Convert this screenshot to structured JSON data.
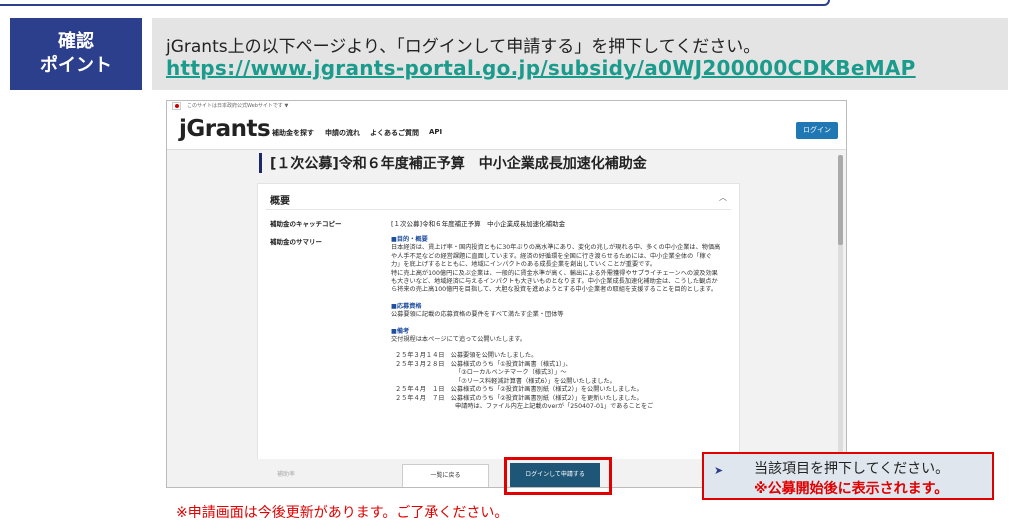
{
  "badge": {
    "line1": "確認",
    "line2": "ポイント"
  },
  "banner": {
    "instruction": "jGrants上の以下ページより、「ログインして申請する」を押下してください。",
    "url": "https://www.jgrants-portal.go.jp/subsidy/a0WJ200000CDKBeMAP"
  },
  "site": {
    "gov_notice": "このサイトは日本政府公式Webサイトです ▼",
    "logo_main": "jGrants",
    "nav": [
      "補助金を探す",
      "申請の流れ",
      "よくあるご質問",
      "API"
    ],
    "login_label": "ログイン",
    "page_title": "[１次公募]令和６年度補正予算　中小企業成長加速化補助金",
    "section_title": "概要",
    "catch_label": "補助金のキャッチコピー",
    "catch_value": "[１次公募]令和６年度補正予算　中小企業成長加速化補助金",
    "summary_label": "補助金のサマリー",
    "summary": {
      "h1": "■目的・概要",
      "p1": "日本経済は、賃上げ率・国内投資ともに30年ぶりの高水準にあり、変化の兆しが現れる中、多くの中小企業は、物価高や人手不足などの経営課題に直面しています。経済の好循環を全国に行き渡らせるためには、中小企業全体の「稼ぐ力」を底上げするとともに、地域にインパクトのある成長企業を創出していくことが重要です。",
      "p2": "特に売上高が100億円に及ぶ企業は、一般的に賃金水準が高く、輸出による外需獲得やサプライチェーンへの波及効果も大きいなど、地域経済に与えるインパクトも大きいものとなります。中小企業成長加速化補助金は、こうした観点から将来の売上高100億円を目指して、大胆な投資を進めようとする中小企業者の取組を支援することを目的とします。",
      "h2": "■応募資格",
      "p3": "公募要領に記載の応募資格の要件をすべて満たす企業・団体等",
      "h3": "■備考",
      "p4": "交付規程は本ページにて追って公開いたします。",
      "n1": "２５年３月１４日　公募要領を公開いたしました。",
      "n2": "２５年３月２８日　公募様式のうち「①投資計画書（様式1）」、",
      "n3": "「③ローカルベンチマーク（様式3）」～",
      "n4": "「⑦リース料軽減計算書（様式6）」を公開いたしました。",
      "n5": "２５年４月　１日　公募様式のうち「②投資計画書別紙（様式2）」を公開いたしました。",
      "n6": "２５年４月　７日　公募様式のうち「②投資計画書別紙（様式2）」を更新いたしました。",
      "n7": "申請時は、ファイル内左上記載のverが「250407-01」であることをご"
    },
    "faint_label": "補助率",
    "back_label": "一覧に戻る",
    "apply_label": "ログインして申請する"
  },
  "callout": {
    "line1": "当該項目を押下してください。",
    "line2": "※公募開始後に表示されます。"
  },
  "note": "※申請画面は今後更新があります。ご了承ください。"
}
